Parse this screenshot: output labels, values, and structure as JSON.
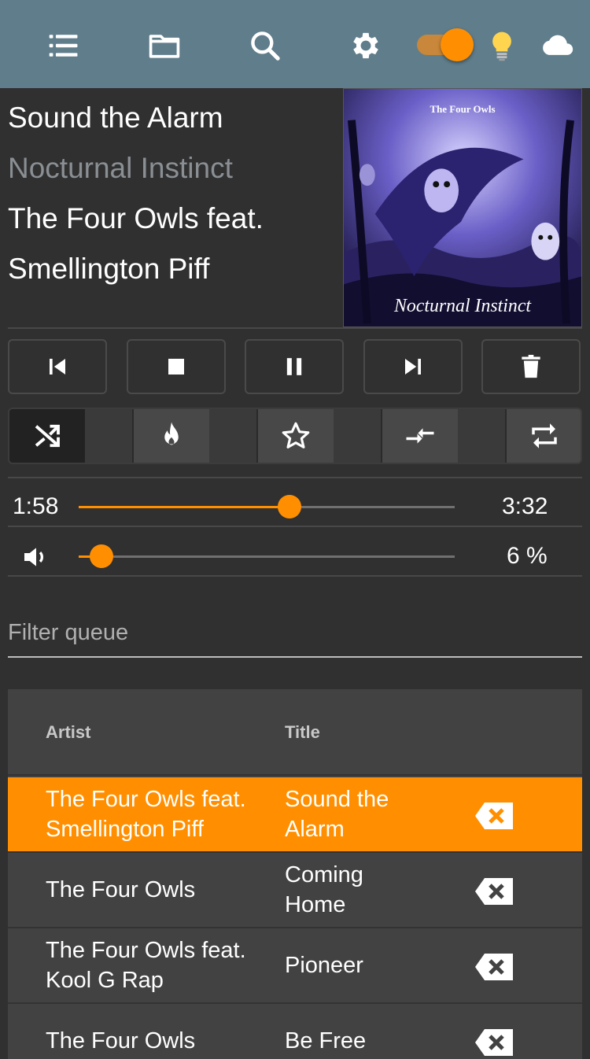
{
  "toolbar": {
    "icons": [
      "queue-list-icon",
      "folder-icon",
      "search-icon",
      "settings-gear-icon",
      "lightbulb-icon",
      "cloud-icon"
    ],
    "toggle_on": true,
    "accent": "#ff8f00",
    "bar_color": "#607d8b"
  },
  "now_playing": {
    "title": "Sound the Alarm",
    "album": "Nocturnal Instinct",
    "artist_line1": "The Four Owls feat.",
    "artist_line2": "Smellington Piff",
    "cover_text": "Nocturnal Instinct",
    "cover_band": "The Four Owls"
  },
  "controls": [
    "previous-icon",
    "stop-icon",
    "pause-icon",
    "next-icon",
    "delete-icon"
  ],
  "modes": [
    "shuffle-icon",
    "fire-icon",
    "star-icon",
    "compress-icon",
    "repeat-icon"
  ],
  "progress": {
    "elapsed": "1:58",
    "total": "3:32",
    "fraction": 0.56
  },
  "volume": {
    "label": "6 %",
    "fraction": 0.06
  },
  "filter": {
    "placeholder": "Filter queue"
  },
  "queue": {
    "headers": {
      "artist": "Artist",
      "title": "Title"
    },
    "rows": [
      {
        "artist": "The Four Owls feat. Smellington Piff",
        "title": "Sound the Alarm",
        "active": true
      },
      {
        "artist": "The Four Owls",
        "title": "Coming Home",
        "active": false
      },
      {
        "artist": "The Four Owls feat. Kool G Rap",
        "title": "Pioneer",
        "active": false
      },
      {
        "artist": "The Four Owls",
        "title": "Be Free",
        "active": false
      }
    ]
  }
}
